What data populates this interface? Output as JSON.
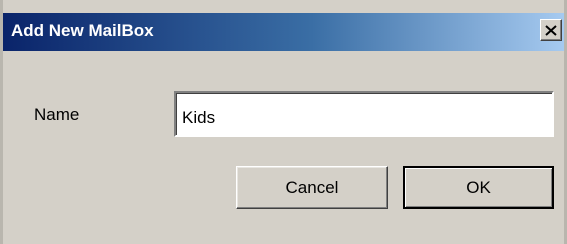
{
  "dialog": {
    "title": "Add New MailBox",
    "close_icon": "close-x-icon"
  },
  "form": {
    "name_label": "Name",
    "name_value": "Kids"
  },
  "buttons": {
    "cancel_label": "Cancel",
    "ok_label": "OK"
  },
  "colors": {
    "titlebar_start": "#0a246a",
    "titlebar_end": "#a6caf0",
    "dialog_background": "#d4d0c8"
  }
}
